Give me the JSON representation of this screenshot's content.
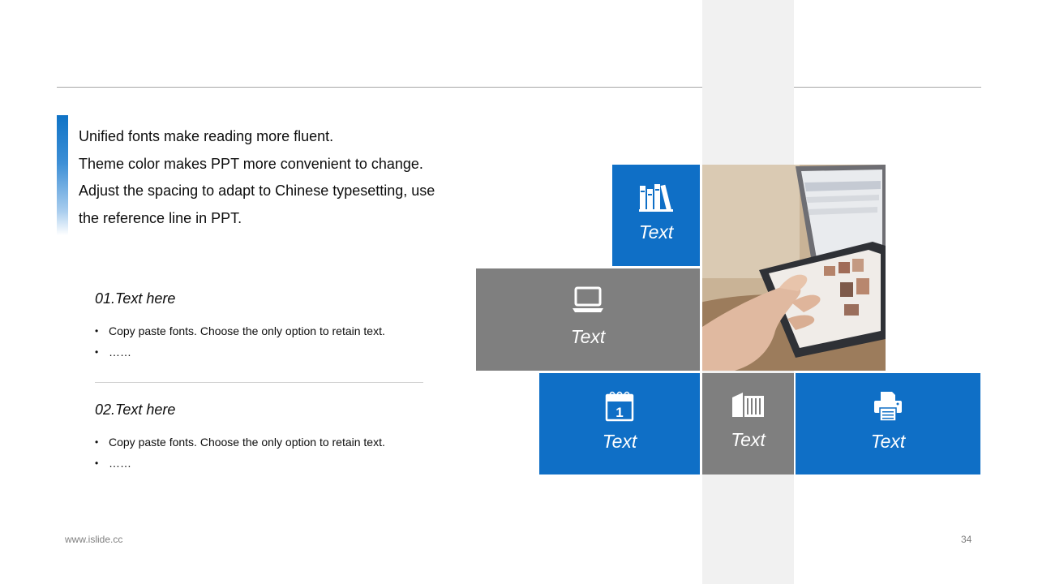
{
  "intro_lines": [
    "Unified fonts make reading more fluent.",
    "Theme color makes PPT more convenient to change.",
    "Adjust the spacing to adapt to Chinese typesetting, use",
    "the reference line in PPT."
  ],
  "sections": [
    {
      "title": "01.Text here",
      "bullets": [
        "Copy paste fonts. Choose the only option to retain text.",
        "……"
      ]
    },
    {
      "title": "02.Text here",
      "bullets": [
        "Copy paste fonts. Choose the only option to retain text.",
        "……"
      ]
    }
  ],
  "tiles": [
    {
      "label": "Text",
      "icon": "books-icon",
      "color": "#0f6fc6"
    },
    {
      "label": "Text",
      "icon": "laptop-icon",
      "color": "#7f7f7f"
    },
    {
      "label": "Text",
      "icon": "calendar-icon",
      "color": "#0f6fc6"
    },
    {
      "label": "Text",
      "icon": "building-icon",
      "color": "#7f7f7f"
    },
    {
      "label": "Text",
      "icon": "printer-icon",
      "color": "#0f6fc6"
    }
  ],
  "photo": {
    "icon": "tablet-hand-photo"
  },
  "colors": {
    "accent": "#0f6fc6",
    "gray_tile": "#7f7f7f",
    "stripe": "#f1f1f1"
  },
  "footer": {
    "url": "www.islide.cc",
    "page": "34"
  }
}
